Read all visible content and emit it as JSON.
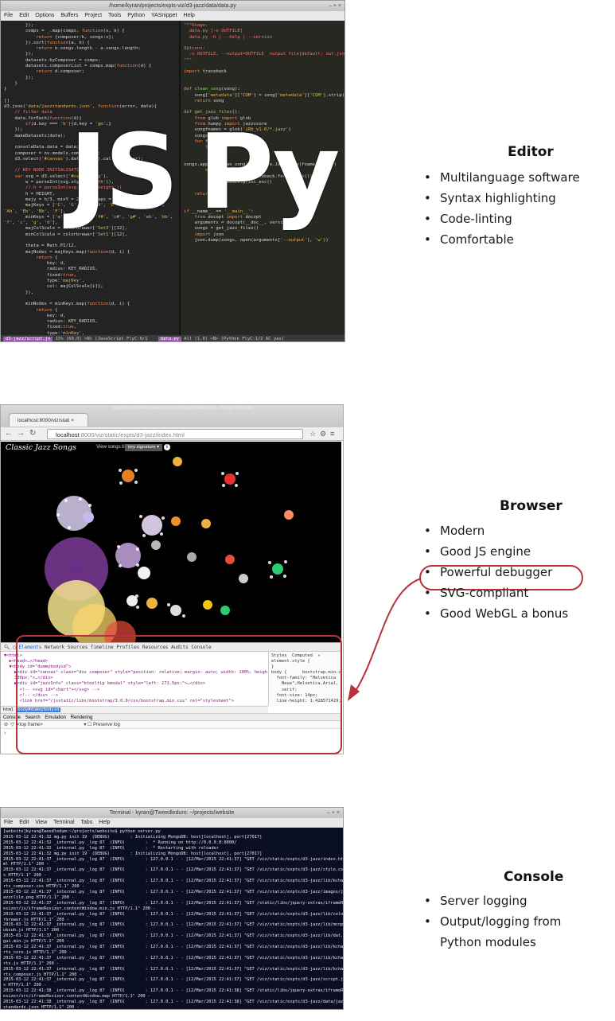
{
  "editor": {
    "window_title": "/home/kyran/projects/expts-viz/d3-jazz/data/data.py",
    "window_controls": "–  +  ×",
    "menu": [
      "File",
      "Edit",
      "Options",
      "Buffers",
      "Project",
      "Tools",
      "Python",
      "YASnippet",
      "Help"
    ],
    "overlay_js": "JS",
    "overlay_py": "Py",
    "modeline_left_file": "d3-jazz/script.js",
    "modeline_left_info": "15% (60,0)   <N>   (JavaScript FlyC:0/1",
    "modeline_right_file": "data.py",
    "modeline_right_info": "All (1,0)    <N>   (Python FlyC:1/2 AC yas)"
  },
  "editor_section": {
    "heading": "Editor",
    "bullets": [
      "Multilanguage software",
      "Syntax highlighting",
      "Code-linting",
      "Comfortable"
    ]
  },
  "browser": {
    "window_title": "localhost:8000/viz/static/expts/d3-jazz/index.html - Google Chrome",
    "tab_title": "localhost:8000/viz/stati ×",
    "url_host": "localhost",
    "url_rest": ":8000/viz/static/expts/d3-jazz/index.html",
    "viz_title": "Classic Jazz Songs",
    "viz_view_label": "View songs by",
    "viz_select": "key signature ▾",
    "viz_info": "i",
    "devtools_tabs": [
      "Elements",
      "Network",
      "Sources",
      "Timeline",
      "Profiles",
      "Resources",
      "Audits",
      "Console"
    ],
    "crumbs": [
      "html",
      "body#dummybodyid"
    ],
    "console_tabs": [
      "Console",
      "Search",
      "Emulation",
      "Rendering"
    ],
    "console_frame": "<top frame>",
    "console_preserve": "Preserve log",
    "styles_tabs": "Styles  Computed  »"
  },
  "browser_section": {
    "heading": "Browser",
    "bullets": [
      "Modern",
      "Good JS engine",
      "Powerful debugger",
      "SVG-compliant",
      "Good WebGL a bonus"
    ]
  },
  "terminal": {
    "window_title": "Terminal - kyran@Tweedledum: ~/projects/website",
    "window_controls": "–  +  ×",
    "menu": [
      "File",
      "Edit",
      "View",
      "Terminal",
      "Tabs",
      "Help"
    ]
  },
  "console_section": {
    "heading": "Console",
    "bullets": [
      "Server logging",
      "Output/logging from",
      "Python modules"
    ]
  },
  "colors": {
    "callout": "#b8323c",
    "editor_bg": "#2b2b2b",
    "terminal_bg": "#0b0f24"
  }
}
